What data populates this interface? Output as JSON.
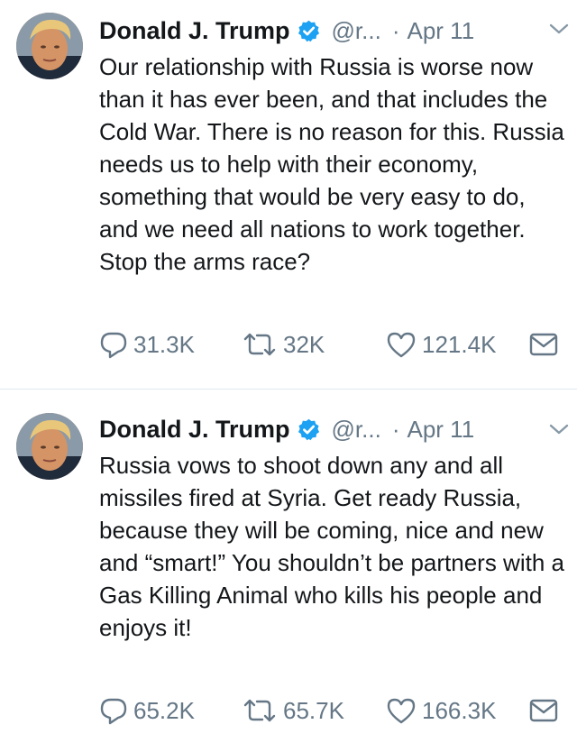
{
  "tweets": [
    {
      "name": "Donald J. Trump",
      "handle": "@r...",
      "separator": "·",
      "date": "Apr 11",
      "text": "Our relationship with Russia is worse now than it has ever been, and that includes the Cold War. There is no reason for this. Russia needs us to help with their economy, something that would be very easy to do, and we need all nations to work together. Stop the arms race?",
      "replies": "31.3K",
      "retweets": "32K",
      "likes": "121.4K"
    },
    {
      "name": "Donald J. Trump",
      "handle": "@r...",
      "separator": "·",
      "date": "Apr 11",
      "text": "Russia vows to shoot down any and all missiles fired at Syria. Get ready Russia,  because they will be coming, nice and new and “smart!” You shouldn’t be partners with a Gas Killing Animal who kills his people and enjoys it!",
      "replies": "65.2K",
      "retweets": "65.7K",
      "likes": "166.3K"
    }
  ],
  "colors": {
    "text": "#14171a",
    "secondary": "#657786",
    "verified": "#1da1f2",
    "divider": "#e1e8ed"
  },
  "icons": [
    "verified-badge-icon",
    "caret-down-icon",
    "reply-icon",
    "retweet-icon",
    "like-icon",
    "direct-message-icon"
  ]
}
